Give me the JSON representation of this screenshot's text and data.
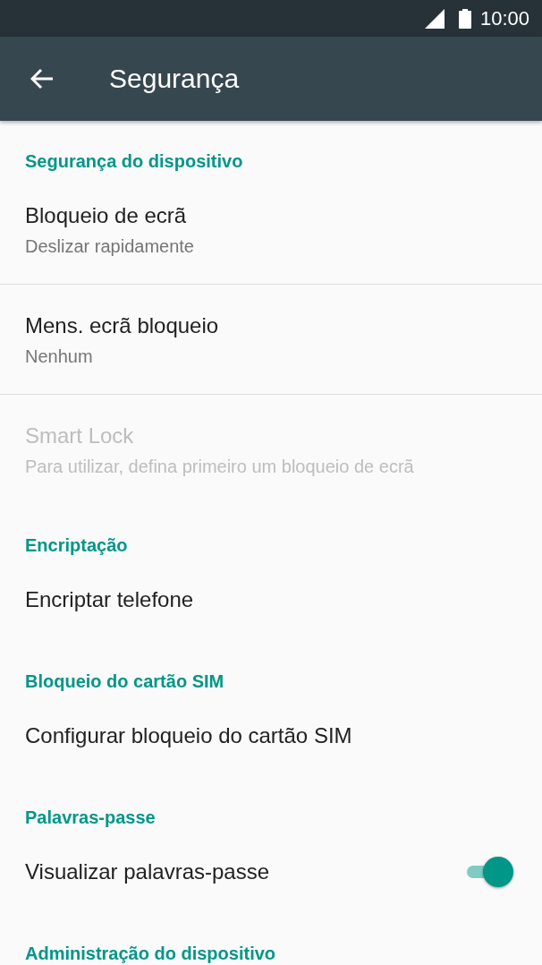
{
  "status_bar": {
    "time": "10:00"
  },
  "app_bar": {
    "title": "Segurança"
  },
  "sections": [
    {
      "title": "Segurança do dispositivo",
      "items": [
        {
          "kind": "text",
          "title": "Bloqueio de ecrã",
          "subtitle": "Deslizar rapidamente",
          "disabled": false
        },
        {
          "kind": "text",
          "title": "Mens. ecrã bloqueio",
          "subtitle": "Nenhum",
          "disabled": false
        },
        {
          "kind": "text",
          "title": "Smart Lock",
          "subtitle": "Para utilizar, defina primeiro um bloqueio de ecrã",
          "disabled": true
        }
      ]
    },
    {
      "title": "Encriptação",
      "items": [
        {
          "kind": "text",
          "title": "Encriptar telefone",
          "disabled": false
        }
      ]
    },
    {
      "title": "Bloqueio do cartão SIM",
      "items": [
        {
          "kind": "text",
          "title": "Configurar bloqueio do cartão SIM",
          "disabled": false
        }
      ]
    },
    {
      "title": "Palavras-passe",
      "items": [
        {
          "kind": "switch",
          "title": "Visualizar palavras-passe",
          "disabled": false,
          "on": true
        }
      ]
    },
    {
      "title": "Administração do dispositivo"
    }
  ]
}
